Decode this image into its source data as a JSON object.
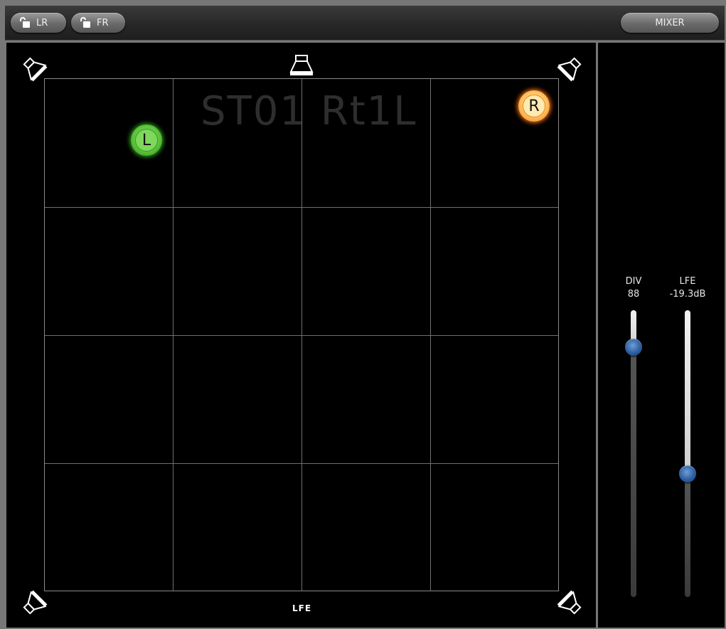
{
  "toolbar": {
    "lr_label": "LR",
    "fr_label": "FR",
    "mixer_label": "MIXER"
  },
  "panner": {
    "channel_name": "ST01 Rt1L",
    "puck_left_label": "L",
    "puck_right_label": "R",
    "lfe_label": "LFE",
    "puck_left_color": "#5cc43b",
    "puck_right_color": "#ffc766"
  },
  "faders": {
    "div": {
      "label": "DIV",
      "value": "88",
      "level": 0.13
    },
    "lfe": {
      "label": "LFE",
      "value": "-19.3dB",
      "level": 0.57
    }
  },
  "colors": {
    "background": "#000000",
    "grid_line": "#6f6f6f",
    "fader_knob": "#2c5ea2"
  }
}
